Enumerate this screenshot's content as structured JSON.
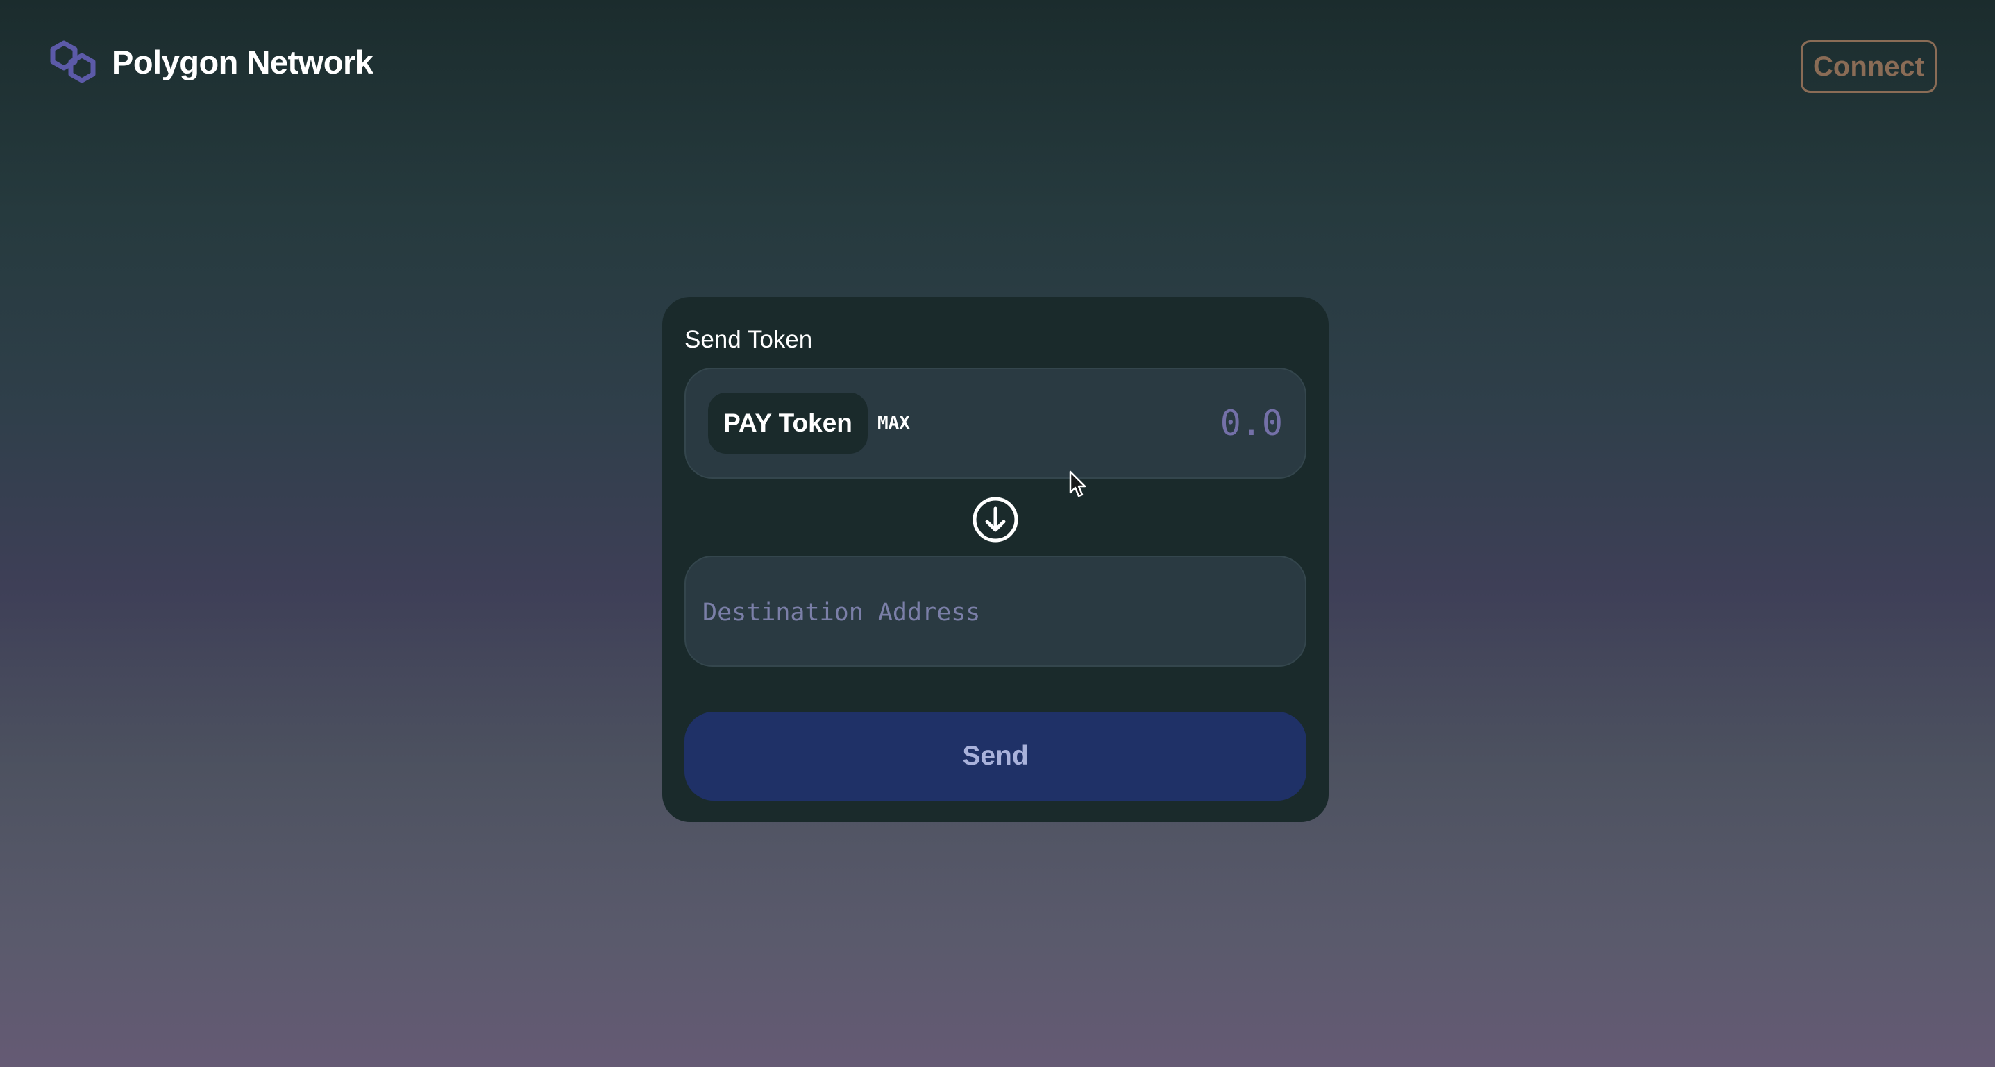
{
  "header": {
    "brand_name": "Polygon Network",
    "logo_icon": "polygon-logo-icon",
    "connect_label": "Connect"
  },
  "send_card": {
    "title": "Send Token",
    "token_label": "PAY Token",
    "max_label": "MAX",
    "amount_value": "",
    "amount_placeholder": "0.0",
    "swap_icon": "arrow-down-circle-icon",
    "destination_value": "",
    "destination_placeholder": "Destination Address",
    "send_label": "Send"
  },
  "colors": {
    "brand_accent": "#5c5aa8",
    "connect_border": "#8a6c56",
    "card_bg": "#1a2a2b",
    "input_bg": "#2a3a42",
    "send_bg": "#1f3167",
    "send_text": "#a9b2db",
    "placeholder": "#7470a8"
  }
}
